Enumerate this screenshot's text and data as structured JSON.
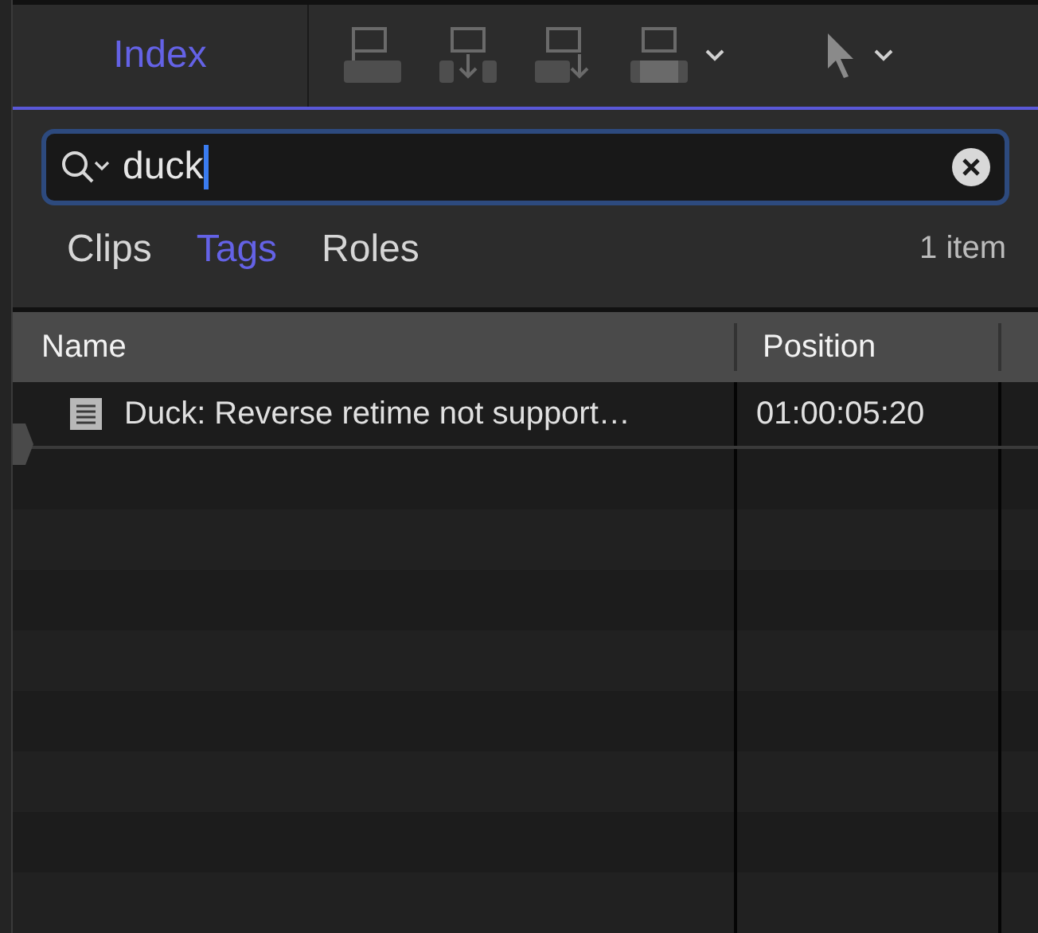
{
  "toolbar": {
    "index_tab": {
      "label": "Index",
      "selected": true
    }
  },
  "search": {
    "value": "duck"
  },
  "filter_tabs": [
    {
      "label": "Clips",
      "selected": false
    },
    {
      "label": "Tags",
      "selected": true
    },
    {
      "label": "Roles",
      "selected": false
    }
  ],
  "item_count": "1 item",
  "table": {
    "columns": [
      "Name",
      "Position"
    ],
    "rows": [
      {
        "name": "Duck: Reverse retime not support…",
        "position": "01:00:05:20"
      }
    ]
  }
}
